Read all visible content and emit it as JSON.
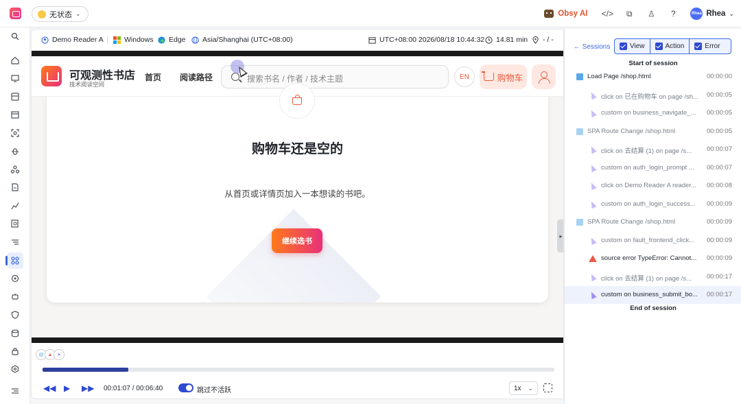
{
  "topbar": {
    "status_label": "无状态",
    "obsy_label": "Obsy AI",
    "user_name": "Rhea",
    "avatar_text": "Rhea"
  },
  "context": {
    "user": "Demo Reader A",
    "os": "Windows",
    "browser": "Edge",
    "timezone": "Asia/Shanghai (UTC+08:00)",
    "datetime": "UTC+08:00 2026/08/18 10:44:32",
    "duration": "14.81 min",
    "location": "- / -"
  },
  "shop": {
    "title": "可观测性书店",
    "subtitle": "技术阅读空间",
    "nav": [
      "首页",
      "阅读路径"
    ],
    "search_placeholder": "搜索书名 / 作者 / 技术主题",
    "lang_label": "EN",
    "cart_label": "购物车",
    "empty_title": "购物车还是空的",
    "empty_desc": "从首页或详情页加入一本想读的书吧。",
    "continue_label": "继续选书"
  },
  "player": {
    "time_display": "00:01:07 / 00:06:40",
    "progress": 0.168,
    "skip_inactive_label": "跳过不活跃",
    "skip_inactive_on": true,
    "speed": "1x"
  },
  "sessions": {
    "back_label": "Sessions",
    "filters": [
      {
        "label": "View",
        "checked": true
      },
      {
        "label": "Action",
        "checked": true
      },
      {
        "label": "Error",
        "checked": true
      }
    ],
    "start_label": "Start of session",
    "end_label": "End of session",
    "events": [
      {
        "kind": "page",
        "text": "Load Page /shop.html",
        "time": "00:00:00"
      },
      {
        "kind": "action",
        "text": "click on 已在购物车 on page /sh...",
        "time": "00:00:05"
      },
      {
        "kind": "action",
        "text": "custom on business_navigate_...",
        "time": "00:00:05"
      },
      {
        "kind": "page",
        "text": "SPA Route Change /shop.html",
        "time": "00:00:05"
      },
      {
        "kind": "action",
        "text": "click on 去结算 (1) on page /s...",
        "time": "00:00:07"
      },
      {
        "kind": "action",
        "text": "custom on auth_login_prompt ...",
        "time": "00:00:07"
      },
      {
        "kind": "action",
        "text": "click on Demo Reader A reader...",
        "time": "00:00:08"
      },
      {
        "kind": "action",
        "text": "custom on auth_login_success...",
        "time": "00:00:09"
      },
      {
        "kind": "page",
        "text": "SPA Route Change /shop.html",
        "time": "00:00:09"
      },
      {
        "kind": "action",
        "text": "custom on fault_frontend_click...",
        "time": "00:00:09"
      },
      {
        "kind": "error",
        "text": "source error TypeError: Cannot...",
        "time": "00:00:09"
      },
      {
        "kind": "action",
        "text": "click on 去结算 (1) on page /s...",
        "time": "00:00:17"
      },
      {
        "kind": "action",
        "text": "custom on business_submit_bo...",
        "time": "00:00:17",
        "selected": true
      }
    ]
  },
  "colors": {
    "accent": "#3b6ae0",
    "brand_gradient_start": "#ff7a1a",
    "brand_gradient_end": "#e8307a",
    "error": "#e85a4a"
  }
}
